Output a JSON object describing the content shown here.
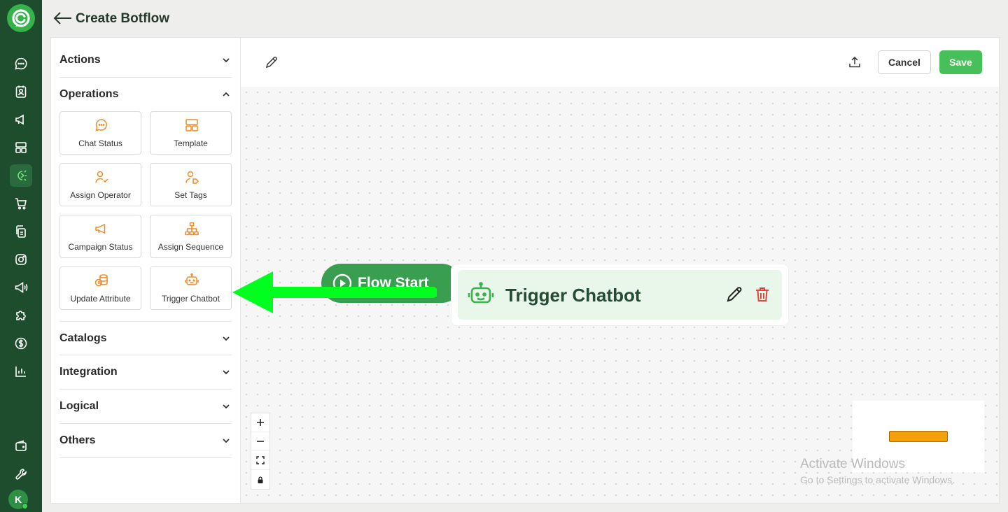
{
  "header": {
    "title": "Create Botflow"
  },
  "nav": {
    "items": [
      "chat-icon",
      "contacts-icon",
      "megaphone-icon",
      "layout-icon",
      "botflow-icon",
      "cart-icon",
      "copy-icon",
      "instagram-icon",
      "broadcast-icon",
      "puzzle-icon",
      "dollar-icon",
      "analytics-icon",
      "wallet-icon",
      "wrench-icon"
    ],
    "active": "botflow-icon",
    "avatar_initial": "K"
  },
  "sidebar": {
    "sections": {
      "actions": "Actions",
      "operations": "Operations",
      "catalogs": "Catalogs",
      "integration": "Integration",
      "logical": "Logical",
      "others": "Others"
    },
    "operations": [
      {
        "label": "Chat Status",
        "icon": "chat-bubble-icon"
      },
      {
        "label": "Template",
        "icon": "template-icon"
      },
      {
        "label": "Assign Operator",
        "icon": "user-check-icon"
      },
      {
        "label": "Set Tags",
        "icon": "user-tag-icon"
      },
      {
        "label": "Campaign Status",
        "icon": "megaphone-icon"
      },
      {
        "label": "Assign Sequence",
        "icon": "hierarchy-icon"
      },
      {
        "label": "Update Attribute",
        "icon": "coins-icon"
      },
      {
        "label": "Trigger Chatbot",
        "icon": "bot-icon"
      }
    ]
  },
  "toolbar": {
    "cancel_label": "Cancel",
    "save_label": "Save"
  },
  "canvas": {
    "flow_start_label": "Flow Start",
    "trigger_node_label": "Trigger Chatbot"
  },
  "watermark": {
    "title": "Activate Windows",
    "subtitle": "Go to Settings to activate Windows."
  },
  "colors": {
    "rail": "#1d4d2c",
    "accent_green": "#47c05c",
    "icon_orange": "#f08a24",
    "delete_red": "#e0463c",
    "arrow_green": "#00ff1e"
  }
}
